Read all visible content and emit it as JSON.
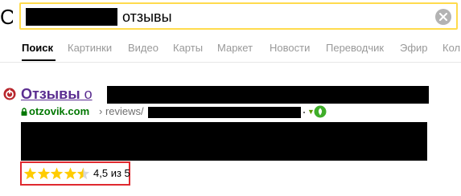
{
  "logo_fragment": "С",
  "search": {
    "query": "отзывы"
  },
  "tabs": [
    {
      "label": "Поиск",
      "active": true
    },
    {
      "label": "Картинки",
      "active": false
    },
    {
      "label": "Видео",
      "active": false
    },
    {
      "label": "Карты",
      "active": false
    },
    {
      "label": "Маркет",
      "active": false
    },
    {
      "label": "Новости",
      "active": false
    },
    {
      "label": "Переводчик",
      "active": false
    },
    {
      "label": "Эфир",
      "active": false
    },
    {
      "label": "Кол",
      "active": false
    }
  ],
  "result": {
    "title_bold": "Отзывы",
    "title_rest": " о",
    "domain": "otzovik.com",
    "path": " › reviews/",
    "favicon_color": "#b8272d",
    "domain_color": "#007700",
    "title_color": "#5b2e91",
    "rating": {
      "value_text": "4,5",
      "of_text": " из 5",
      "stars_fraction": 0.9
    },
    "highlight_color": "#e0292f"
  },
  "icons": {
    "clear": "close-circle-icon",
    "favicon": "otzovik-favicon-icon",
    "lock": "lock-icon",
    "eco": "green-eco-badge-icon"
  }
}
